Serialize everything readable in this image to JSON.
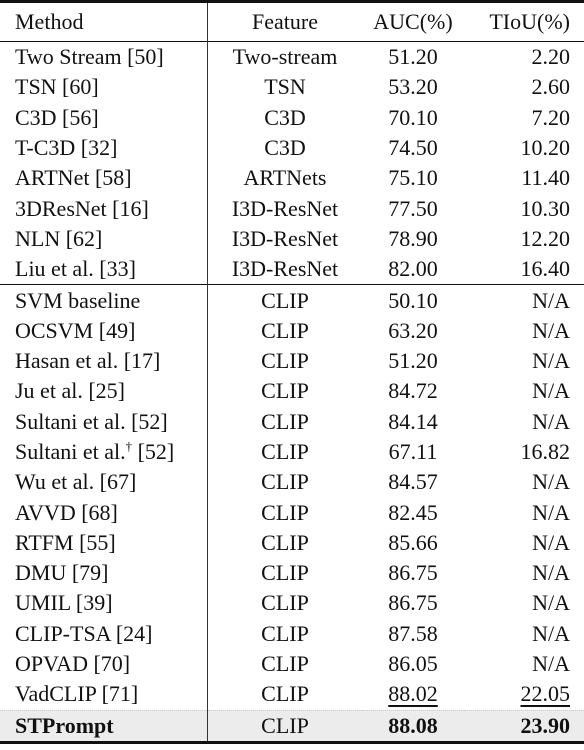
{
  "table": {
    "headers": {
      "method": "Method",
      "feature": "Feature",
      "auc": "AUC(%)",
      "tiou": "TIoU(%)"
    },
    "rows": [
      {
        "method": "Two Stream [50]",
        "feature": "Two-stream",
        "auc": "51.20",
        "tiou": "2.20"
      },
      {
        "method": "TSN [60]",
        "feature": "TSN",
        "auc": "53.20",
        "tiou": "2.60"
      },
      {
        "method": "C3D [56]",
        "feature": "C3D",
        "auc": "70.10",
        "tiou": "7.20"
      },
      {
        "method": "T-C3D [32]",
        "feature": "C3D",
        "auc": "74.50",
        "tiou": "10.20"
      },
      {
        "method": "ARTNet [58]",
        "feature": "ARTNets",
        "auc": "75.10",
        "tiou": "11.40"
      },
      {
        "method": "3DResNet [16]",
        "feature": "I3D-ResNet",
        "auc": "77.50",
        "tiou": "10.30"
      },
      {
        "method": "NLN [62]",
        "feature": "I3D-ResNet",
        "auc": "78.90",
        "tiou": "12.20"
      },
      {
        "method": "Liu et al. [33]",
        "feature": "I3D-ResNet",
        "auc": "82.00",
        "tiou": "16.40"
      },
      {
        "method": "SVM baseline",
        "feature": "CLIP",
        "auc": "50.10",
        "tiou": "N/A"
      },
      {
        "method": "OCSVM [49]",
        "feature": "CLIP",
        "auc": "63.20",
        "tiou": "N/A"
      },
      {
        "method": "Hasan et al. [17]",
        "feature": "CLIP",
        "auc": "51.20",
        "tiou": "N/A"
      },
      {
        "method": "Ju et al. [25]",
        "feature": "CLIP",
        "auc": "84.72",
        "tiou": "N/A"
      },
      {
        "method": "Sultani et al. [52]",
        "feature": "CLIP",
        "auc": "84.14",
        "tiou": "N/A"
      },
      {
        "method": "Sultani et al.",
        "method_sup": "†",
        "method_ref": " [52]",
        "feature": "CLIP",
        "auc": "67.11",
        "tiou": "16.82"
      },
      {
        "method": "Wu et al. [67]",
        "feature": "CLIP",
        "auc": "84.57",
        "tiou": "N/A"
      },
      {
        "method": "AVVD [68]",
        "feature": "CLIP",
        "auc": "82.45",
        "tiou": "N/A"
      },
      {
        "method": "RTFM [55]",
        "feature": "CLIP",
        "auc": "85.66",
        "tiou": "N/A"
      },
      {
        "method": "DMU [79]",
        "feature": "CLIP",
        "auc": "86.75",
        "tiou": "N/A"
      },
      {
        "method": "UMIL [39]",
        "feature": "CLIP",
        "auc": "86.75",
        "tiou": "N/A"
      },
      {
        "method": "CLIP-TSA [24]",
        "feature": "CLIP",
        "auc": "87.58",
        "tiou": "N/A"
      },
      {
        "method": "OPVAD [70]",
        "feature": "CLIP",
        "auc": "86.05",
        "tiou": "N/A"
      },
      {
        "method": "VadCLIP [71]",
        "feature": "CLIP",
        "auc": "88.02",
        "tiou": "22.05",
        "underline": true
      },
      {
        "method": "STPrompt",
        "feature": "CLIP",
        "auc": "88.08",
        "tiou": "23.90",
        "highlight": true
      }
    ]
  }
}
